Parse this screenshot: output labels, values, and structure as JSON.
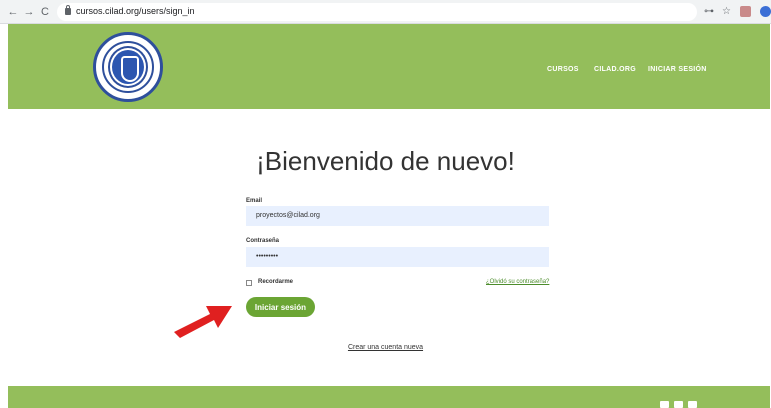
{
  "browser": {
    "back_icon": "←",
    "forward_icon": "→",
    "reload_icon": "C",
    "url": "cursos.cilad.org/users/sign_in",
    "key_icon": "⊶",
    "star_icon": "☆"
  },
  "header": {
    "nav": [
      "CURSOS",
      "CILAD.ORG",
      "INICIAR SESIÓN"
    ]
  },
  "main": {
    "title": "¡Bienvenido de nuevo!",
    "email_label": "Email",
    "email_value": "proyectos@cilad.org",
    "password_label": "Contraseña",
    "password_value": "•••••••••",
    "remember_label": "Recordarme",
    "forgot_link": "¿Olvidó su contraseña?",
    "submit_label": "Iniciar sesión",
    "create_link": "Crear una cuenta nueva"
  },
  "colors": {
    "header_green": "#94be5b",
    "button_green": "#6ba534",
    "field_bg": "#e8f0fe",
    "arrow_red": "#e02020",
    "logo_blue": "#2e4f9c"
  }
}
